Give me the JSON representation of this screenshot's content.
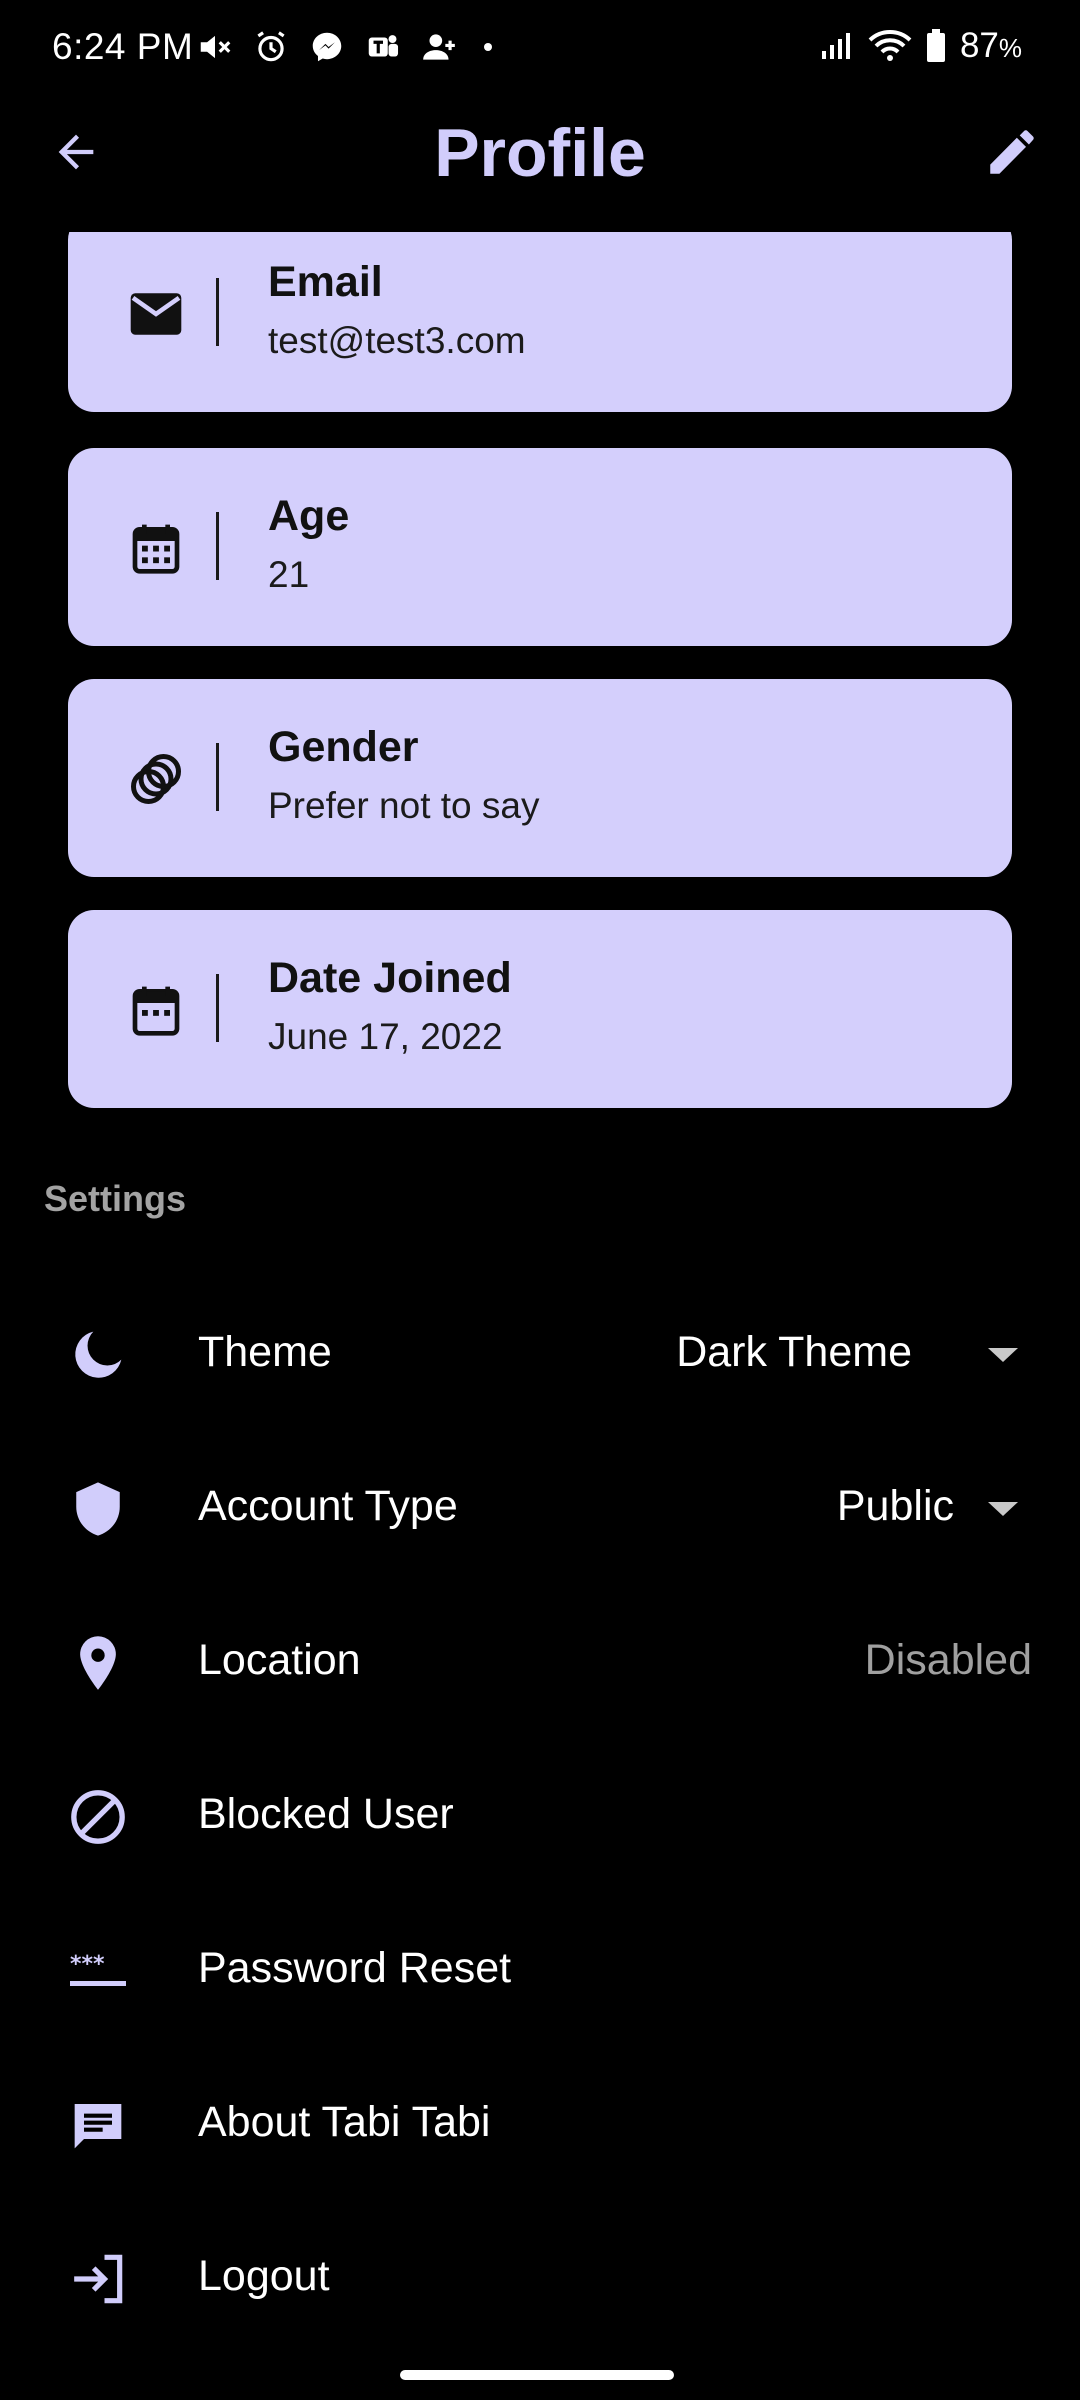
{
  "status_bar": {
    "time": "6:24 PM",
    "battery_percent": "87",
    "battery_unit": "%",
    "notification_icons": [
      "mute-icon",
      "alarm-icon",
      "messenger-icon",
      "teams-icon",
      "add-contact-icon"
    ]
  },
  "app_bar": {
    "title": "Profile",
    "back_icon": "arrow-back-icon",
    "edit_icon": "pencil-icon"
  },
  "profile_fields": [
    {
      "label": "Email",
      "value": "test@test3.com",
      "icon": "mail-icon"
    },
    {
      "label": "Age",
      "value": "21",
      "icon": "calendar-icon"
    },
    {
      "label": "Gender",
      "value": "Prefer not to say",
      "icon": "gender-rings-icon"
    },
    {
      "label": "Date Joined",
      "value": "June 17, 2022",
      "icon": "calendar-event-icon"
    }
  ],
  "settings": {
    "header": "Settings",
    "items": [
      {
        "label": "Theme",
        "value": "Dark Theme",
        "icon": "moon-icon",
        "dropdown": true
      },
      {
        "label": "Account Type",
        "value": "Public",
        "icon": "shield-icon",
        "dropdown": true
      },
      {
        "label": "Location",
        "value": "Disabled",
        "icon": "location-pin-icon",
        "dropdown": false
      },
      {
        "label": "Blocked User",
        "icon": "block-icon"
      },
      {
        "label": "Password Reset",
        "icon": "password-icon"
      },
      {
        "label": "About Tabi Tabi",
        "icon": "chat-message-icon"
      },
      {
        "label": "Logout",
        "icon": "logout-icon"
      }
    ]
  },
  "colors": {
    "background": "#000000",
    "card": "#d4cffc",
    "accent": "#d1cdfb",
    "muted_text": "#a0a0a0"
  }
}
